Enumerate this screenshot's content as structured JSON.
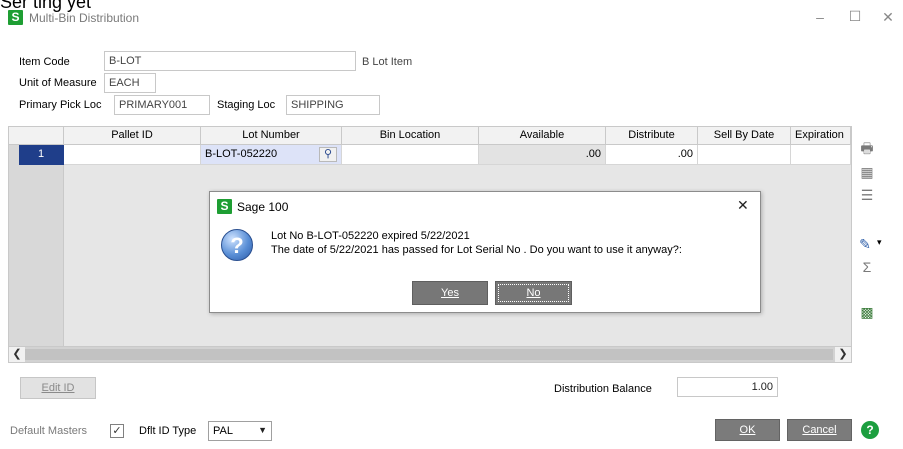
{
  "window": {
    "title": "Multi-Bin Distribution",
    "logo_letter": "S",
    "top_cropped_text": "Ser ting yet"
  },
  "header": {
    "item_code_label": "Item Code",
    "item_code_value": "B-LOT",
    "item_description": "B Lot Item",
    "uom_label": "Unit of Measure",
    "uom_value": "EACH",
    "primary_pick_label": "Primary Pick Loc",
    "primary_pick_value": "PRIMARY001",
    "staging_label": "Staging Loc",
    "staging_value": "SHIPPING"
  },
  "grid": {
    "columns": [
      "Pallet ID",
      "Lot Number",
      "Bin Location",
      "Available",
      "Distribute",
      "Sell By Date",
      "Expiration"
    ],
    "rows": [
      {
        "num": "1",
        "pallet_id": "",
        "lot_number": "B-LOT-052220",
        "bin_location": "",
        "available": ".00",
        "distribute": ".00",
        "sell_by": "",
        "expiration": ""
      }
    ]
  },
  "dialog": {
    "title": "Sage 100",
    "logo_letter": "S",
    "line1": "Lot No B-LOT-052220 expired 5/22/2021",
    "line2": "The  date of 5/22/2021 has passed for Lot Serial No .  Do you want to use it anyway?:",
    "yes_label": "Yes",
    "no_label": "No",
    "close_glyph": "✕"
  },
  "footer": {
    "edit_id_label": "Edit ID",
    "distribution_balance_label": "Distribution Balance",
    "distribution_balance_value": "1.00",
    "default_masters_label": "Default Masters",
    "default_masters_checked": true,
    "dflt_id_type_label": "Dflt ID Type",
    "dflt_id_type_value": "PAL",
    "ok_label": "OK",
    "cancel_label": "Cancel"
  },
  "colors": {
    "sage_green": "#1e9e33",
    "row_number_blue": "#1f3e8a",
    "button_gray": "#7b7b7b"
  }
}
